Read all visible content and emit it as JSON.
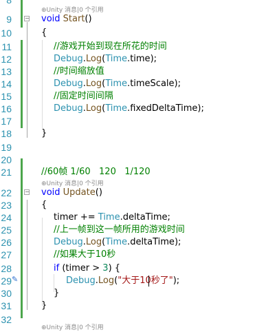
{
  "codelens": {
    "top": "⊕Unity 消息|0 个引用",
    "update": "⊕Unity 消息|0 个引用",
    "bottom": "⊕Unity 消息|0 个引用"
  },
  "line_numbers": [
    "8",
    "9",
    "10",
    "11",
    "12",
    "13",
    "14",
    "15",
    "16",
    "17",
    "18",
    "19",
    "20",
    "21",
    "22",
    "23",
    "24",
    "25",
    "26",
    "27",
    "28",
    "29",
    "30",
    "31",
    "32"
  ],
  "code": {
    "start_decl": {
      "kw": "void",
      "name": "Start",
      "rest": "()"
    },
    "open_brace_1": "{",
    "comment_1": "//游戏开始到现在所花的时间",
    "log_time": {
      "obj": "Debug",
      "method": "Log",
      "cls": "Time",
      "prop": "time",
      "tail": ");"
    },
    "comment_2": "//时间缩放值",
    "log_timescale": {
      "obj": "Debug",
      "method": "Log",
      "cls": "Time",
      "prop": "timeScale",
      "tail": ");"
    },
    "comment_3": "//固定时间间隔",
    "log_fixed": {
      "obj": "Debug",
      "method": "Log",
      "cls": "Time",
      "prop": "fixedDeltaTime",
      "tail": ");"
    },
    "close_brace_1": "}",
    "comment_fps": "//60帧 1/60   120   1/120",
    "update_decl": {
      "kw": "void",
      "name": "Update",
      "rest": "()"
    },
    "open_brace_2": "{",
    "timer_line": {
      "var": "timer",
      "op": " += ",
      "cls": "Time",
      "prop": "deltaTime",
      "tail": ";"
    },
    "comment_4": "//上一帧到这一帧所用的游戏时间",
    "log_delta": {
      "obj": "Debug",
      "method": "Log",
      "cls": "Time",
      "prop": "deltaTime",
      "tail": ");"
    },
    "comment_5": "//如果大于10秒",
    "if_line": {
      "kw": "if",
      "cond_a": " (timer > ",
      "num": "3",
      "cond_b": ") {"
    },
    "log_str": {
      "obj": "Debug",
      "method": "Log",
      "str": "\"大于10秒了\"",
      "tail": ");"
    },
    "close_if": "}",
    "close_brace_2": "}"
  },
  "colors": {
    "keyword": "#0000ff",
    "type": "#2b91af",
    "comment": "#008000",
    "string": "#a31515",
    "line_number": "#2b91af",
    "change_bar": "#4ca64c"
  }
}
